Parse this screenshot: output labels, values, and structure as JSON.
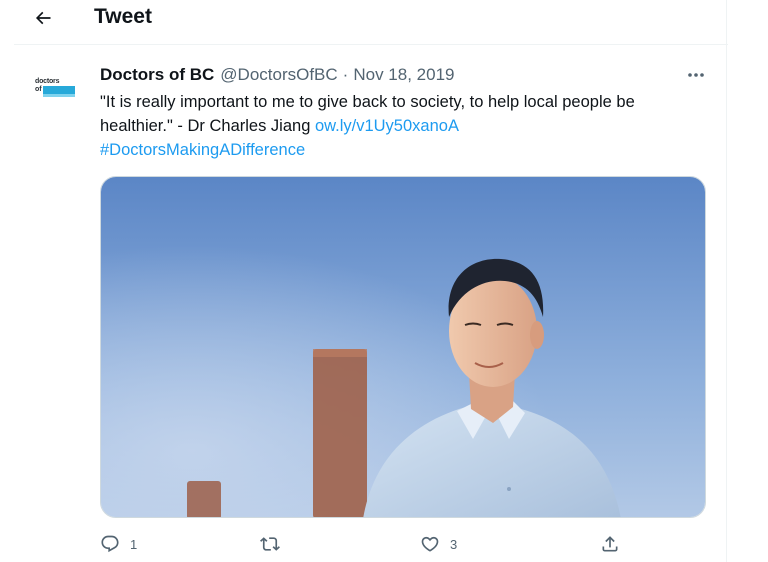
{
  "header": {
    "title": "Tweet",
    "back_icon": "arrow-left-icon"
  },
  "tweet": {
    "author": {
      "name": "Doctors of BC",
      "handle": "@DoctorsOfBC",
      "avatar_logo_text_1": "doctors",
      "avatar_logo_text_2": "of",
      "avatar_logo_text_3": "bc"
    },
    "separator": "·",
    "date": "Nov 18, 2019",
    "text_quote": "\"It is really important to me to give back to society, to help local people be healthier.\" - Dr Charles Jiang ",
    "link": "ow.ly/v1Uy50xanoA",
    "hashtag": "#DoctorsMakingADifference",
    "image_description_icon": "photo-man-sky",
    "actions": {
      "reply_count": "1",
      "retweet_count": "",
      "like_count": "3",
      "share_count": ""
    }
  },
  "colors": {
    "link": "#1d9bf0",
    "text_secondary": "#536471",
    "text_primary": "#0f1419",
    "brand": "#27a9d9"
  }
}
